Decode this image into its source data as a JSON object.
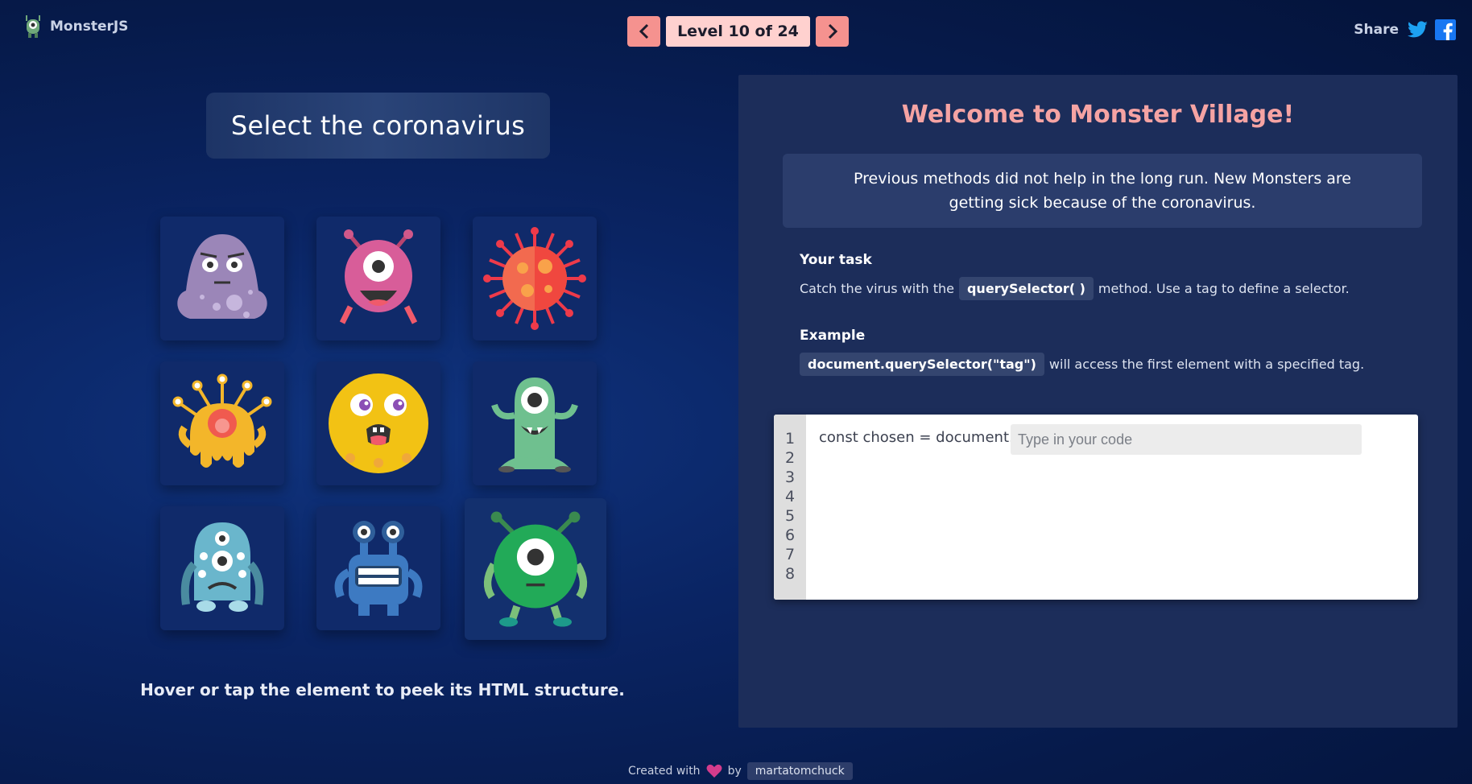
{
  "app": {
    "name": "MonsterJS",
    "logo_icon": "monster-logo-icon"
  },
  "level_nav": {
    "label": "Level 10 of 24",
    "prev_icon": "chevron-left-icon",
    "next_icon": "chevron-right-icon"
  },
  "share": {
    "label": "Share",
    "icons": [
      "twitter-icon",
      "facebook-icon"
    ]
  },
  "task": {
    "title": "Select the coronavirus"
  },
  "monsters": [
    {
      "icon": "purple-blob-monster-icon"
    },
    {
      "icon": "pink-cyclops-monster-icon"
    },
    {
      "icon": "coronavirus-icon"
    },
    {
      "icon": "yellow-octopus-monster-icon"
    },
    {
      "icon": "yellow-round-monster-icon"
    },
    {
      "icon": "green-antenna-cyclops-icon"
    },
    {
      "icon": "blue-three-eyed-monster-icon"
    },
    {
      "icon": "blue-toothy-monster-icon"
    },
    {
      "icon": "green-round-cyclops-icon"
    }
  ],
  "hint": "Hover or tap the element to peek its HTML structure.",
  "panel": {
    "title": "Welcome to Monster Village!",
    "intro": "Previous methods did not help in the long run. New Monsters are getting sick because of the coronavirus.",
    "task_head": "Your task",
    "task_pre": "Catch the virus with the",
    "task_code": "querySelector( )",
    "task_post": "method. Use a tag to define a selector.",
    "example_head": "Example",
    "example_code": "document.querySelector(\"tag\")",
    "example_post": "will access the first element with a specified tag."
  },
  "editor": {
    "line_numbers": [
      "1",
      "2",
      "3",
      "4",
      "5",
      "6",
      "7",
      "8"
    ],
    "code_prefix": "const chosen = document.",
    "input_value": "",
    "input_placeholder": "Type in your code"
  },
  "footer": {
    "created_with": "Created with",
    "by": "by",
    "author": "martatomchuck",
    "heart_icon": "heart-icon"
  },
  "colors": {
    "accent": "#f5928f",
    "title_pink": "#f5a3a3",
    "panel": "#1c2d5a"
  }
}
